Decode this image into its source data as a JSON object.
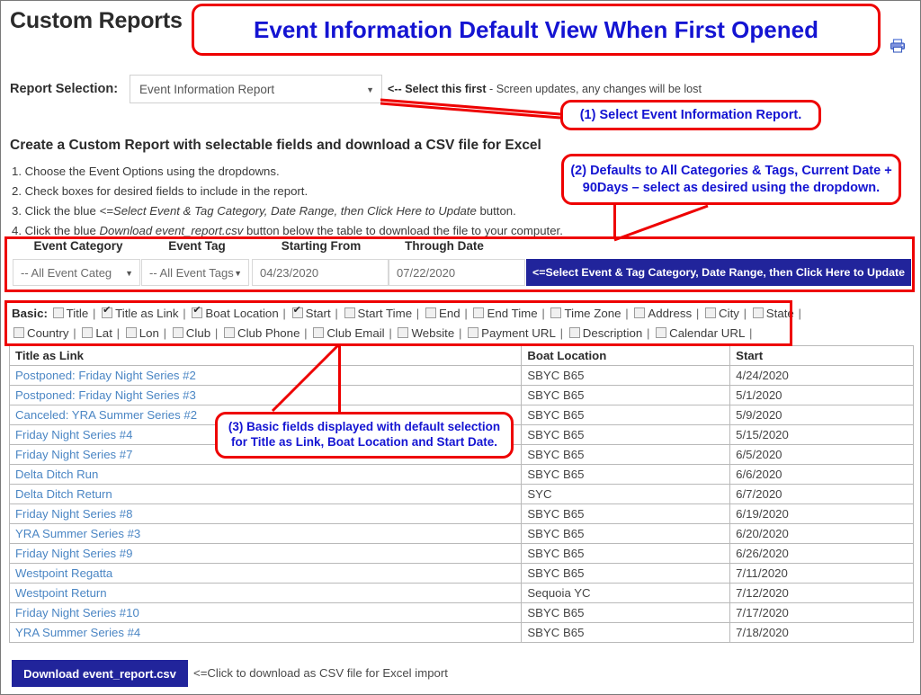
{
  "header": {
    "page_title": "Custom Reports",
    "print_icon": "printer-icon"
  },
  "annotations": {
    "banner_title": "Event Information Default View When First Opened",
    "callout_1": "(1) Select Event Information Report.",
    "callout_2": "(2) Defaults to All Categories & Tags, Current Date + 90Days – select as desired using the dropdown.",
    "callout_3": "(3) Basic fields displayed with default selection for Title as Link, Boat Location and Start Date.",
    "accent_color": "#ee0000",
    "text_color": "#1414d2"
  },
  "report_selection": {
    "label": "Report Selection:",
    "value": "Event Information Report",
    "caret_icon": "chevron-down-icon",
    "hint_bold": "<-- Select this first",
    "hint_rest": " - Screen updates, any changes will be lost"
  },
  "instructions": {
    "heading": "Create a Custom Report with selectable fields and download a CSV file for Excel",
    "step1": "1. Choose the Event Options using the dropdowns.",
    "step2": "2. Check boxes for desired fields to include in the report.",
    "step3_pre": "3. Click the blue ",
    "step3_em": "<=Select Event & Tag Category, Date Range, then Click Here to Update",
    "step3_post": " button.",
    "step4_pre": "4. Click the blue ",
    "step4_em": "Download event_report.csv",
    "step4_post": " button below the table to download the file to your computer."
  },
  "filter_bar": {
    "headers": {
      "event_category": "Event Category",
      "event_tag": "Event Tag",
      "starting_from": "Starting From",
      "through_date": "Through Date"
    },
    "event_category_value": "-- All Event Categ",
    "event_tag_value": "-- All Event Tags",
    "starting_from_value": "04/23/2020",
    "through_date_value": "07/22/2020",
    "update_button": "<=Select Event & Tag Category, Date Range, then Click Here to Update",
    "button_color": "#21249b"
  },
  "field_options": {
    "group_label": "Basic:",
    "row1": [
      {
        "label": "Title",
        "checked": false
      },
      {
        "label": "Title as Link",
        "checked": true
      },
      {
        "label": "Boat Location",
        "checked": true
      },
      {
        "label": "Start",
        "checked": true
      },
      {
        "label": "Start Time",
        "checked": false
      },
      {
        "label": "End",
        "checked": false
      },
      {
        "label": "End Time",
        "checked": false
      },
      {
        "label": "Time Zone",
        "checked": false
      },
      {
        "label": "Address",
        "checked": false
      },
      {
        "label": "City",
        "checked": false
      },
      {
        "label": "State",
        "checked": false
      }
    ],
    "row2": [
      {
        "label": "Country",
        "checked": false
      },
      {
        "label": "Lat",
        "checked": false
      },
      {
        "label": "Lon",
        "checked": false
      },
      {
        "label": "Club",
        "checked": false
      },
      {
        "label": "Club Phone",
        "checked": false
      },
      {
        "label": "Club Email",
        "checked": false
      },
      {
        "label": "Website",
        "checked": false
      },
      {
        "label": "Payment URL",
        "checked": false
      },
      {
        "label": "Description",
        "checked": false
      },
      {
        "label": "Calendar URL",
        "checked": false
      }
    ]
  },
  "report_table": {
    "columns": [
      "Title as Link",
      "Boat Location",
      "Start"
    ],
    "link_color": "#4b86c4",
    "rows": [
      {
        "title": "Postponed: Friday Night Series #2",
        "location": "SBYC B65",
        "start": "4/24/2020"
      },
      {
        "title": "Postponed: Friday Night Series #3",
        "location": "SBYC B65",
        "start": "5/1/2020"
      },
      {
        "title": "Canceled: YRA Summer Series #2",
        "location": "SBYC B65",
        "start": "5/9/2020"
      },
      {
        "title": "Friday Night Series #4",
        "location": "SBYC B65",
        "start": "5/15/2020"
      },
      {
        "title": "Friday Night Series #7",
        "location": "SBYC B65",
        "start": "6/5/2020"
      },
      {
        "title": "Delta Ditch Run",
        "location": "SBYC B65",
        "start": "6/6/2020"
      },
      {
        "title": "Delta Ditch Return",
        "location": "SYC",
        "start": "6/7/2020"
      },
      {
        "title": "Friday Night Series #8",
        "location": "SBYC B65",
        "start": "6/19/2020"
      },
      {
        "title": "YRA Summer Series #3",
        "location": "SBYC B65",
        "start": "6/20/2020"
      },
      {
        "title": "Friday Night Series #9",
        "location": "SBYC B65",
        "start": "6/26/2020"
      },
      {
        "title": "Westpoint Regatta",
        "location": "SBYC B65",
        "start": "7/11/2020"
      },
      {
        "title": "Westpoint Return",
        "location": "Sequoia YC",
        "start": "7/12/2020"
      },
      {
        "title": "Friday Night Series #10",
        "location": "SBYC B65",
        "start": "7/17/2020"
      },
      {
        "title": "YRA Summer Series #4",
        "location": "SBYC B65",
        "start": "7/18/2020"
      }
    ]
  },
  "download": {
    "button_label": "Download event_report.csv",
    "hint": "<=Click to download as CSV file for Excel import"
  }
}
